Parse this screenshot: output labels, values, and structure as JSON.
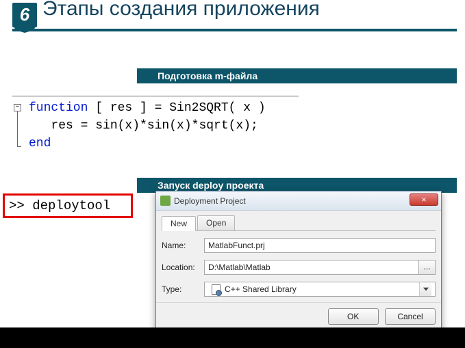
{
  "slide": {
    "number": "6",
    "title": "Этапы создания приложения"
  },
  "sections": {
    "prepare": "Подготовка m-файла",
    "deploy": "Запуск deploy проекта"
  },
  "code": {
    "fn_kw": "function",
    "fn_sig": " [ res ] = Sin2SQRT( x )",
    "body": "   res = sin(x)*sin(x)*sqrt(x);",
    "end_kw": "end"
  },
  "prompt": {
    "text": ">> deploytool"
  },
  "dialog": {
    "title": "Deployment Project",
    "close_glyph": "×",
    "tabs": {
      "new": "New",
      "open": "Open"
    },
    "labels": {
      "name": "Name:",
      "location": "Location:",
      "type": "Type:"
    },
    "values": {
      "name": "MatlabFunct.prj",
      "location": "D:\\Matlab\\Matlab",
      "type": "C++ Shared Library",
      "browse": "..."
    },
    "buttons": {
      "ok": "OK",
      "cancel": "Cancel"
    }
  }
}
